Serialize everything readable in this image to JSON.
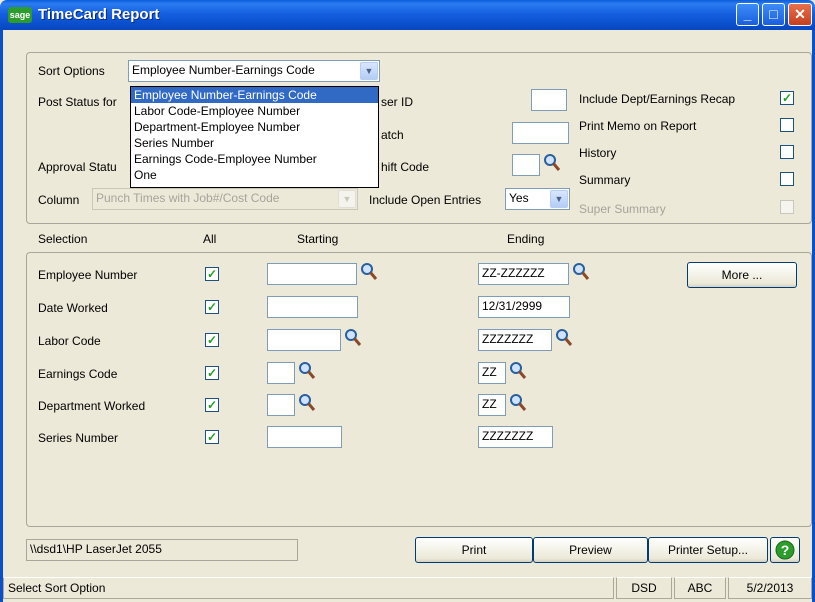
{
  "window": {
    "title": "TimeCard Report",
    "logo": "sage"
  },
  "sort_options": {
    "label": "Sort Options",
    "selected": "Employee Number-Earnings Code",
    "options": [
      "Employee Number-Earnings Code",
      "Labor Code-Employee Number",
      "Department-Employee Number",
      "Series Number",
      "Earnings Code-Employee Number",
      "One"
    ]
  },
  "left_labels": {
    "post_status": "Post Status for",
    "approval_status": "Approval Statu",
    "column": "Column",
    "column_value": "Punch Times with Job#/Cost Code"
  },
  "middle_labels": {
    "user_id": "ser ID",
    "batch": "atch",
    "shift_code": "hift Code",
    "include_open_entries": "Include Open Entries",
    "include_open_value": "Yes"
  },
  "right_options": [
    {
      "label": "Include Dept/Earnings Recap",
      "checked": true,
      "enabled": true
    },
    {
      "label": "Print Memo on Report",
      "checked": false,
      "enabled": true
    },
    {
      "label": "History",
      "checked": false,
      "enabled": true
    },
    {
      "label": "Summary",
      "checked": false,
      "enabled": true
    },
    {
      "label": "Super Summary",
      "checked": false,
      "enabled": false
    }
  ],
  "selection_headers": {
    "selection": "Selection",
    "all": "All",
    "starting": "Starting",
    "ending": "Ending"
  },
  "selection_rows": [
    {
      "label": "Employee Number",
      "all": true,
      "starting": "",
      "ending": "ZZ-ZZZZZZ"
    },
    {
      "label": "Date Worked",
      "all": true,
      "starting": "",
      "ending": "12/31/2999"
    },
    {
      "label": "Labor Code",
      "all": true,
      "starting": "",
      "ending": "ZZZZZZZ"
    },
    {
      "label": "Earnings Code",
      "all": true,
      "starting": "",
      "ending": "ZZ"
    },
    {
      "label": "Department Worked",
      "all": true,
      "starting": "",
      "ending": "ZZ"
    },
    {
      "label": "Series Number",
      "all": true,
      "starting": "",
      "ending": "ZZZZZZZ"
    }
  ],
  "buttons": {
    "more": "More ...",
    "print": "Print",
    "preview": "Preview",
    "printer_setup": "Printer Setup..."
  },
  "printer": "\\\\dsd1\\HP LaserJet 2055",
  "status": {
    "message": "Select Sort Option",
    "company": "DSD",
    "code": "ABC",
    "date": "5/2/2013"
  },
  "icons": [
    "minimize-icon",
    "maximize-icon",
    "close-icon",
    "magnifier-icon",
    "help-icon",
    "checkmark-icon",
    "chevron-down-icon"
  ]
}
